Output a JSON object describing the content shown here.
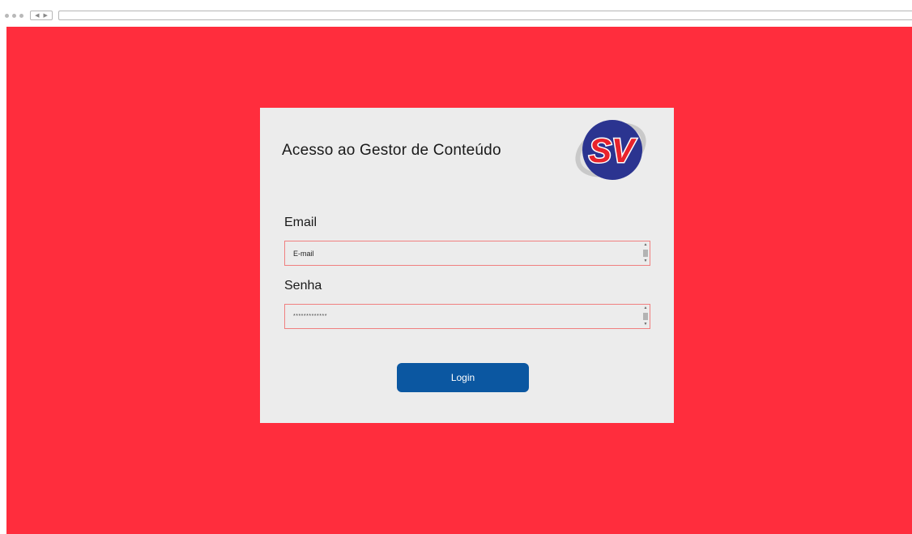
{
  "colors": {
    "page_background": "#ff2d3d",
    "card_background": "#ececec",
    "button_background": "#0b57a1",
    "field_border": "#f08080"
  },
  "login": {
    "title": "Acesso ao Gestor de Conteúdo",
    "logo_text": "SV",
    "email": {
      "label": "Email",
      "value": "E-mail"
    },
    "password": {
      "label": "Senha",
      "value": "*************"
    },
    "submit_label": "Login"
  }
}
